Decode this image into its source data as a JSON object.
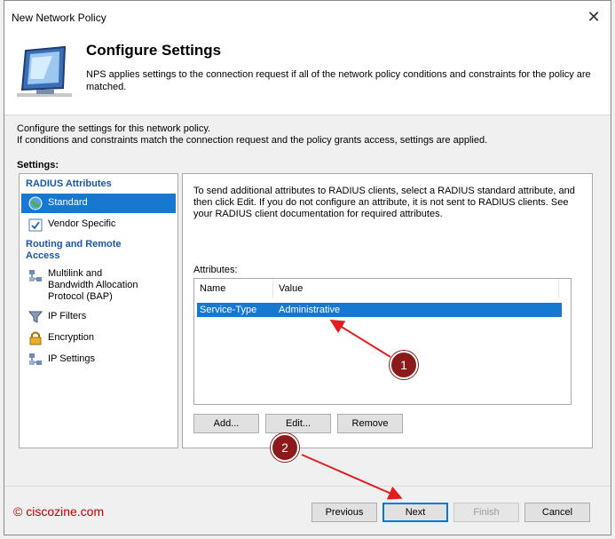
{
  "window": {
    "title": "New Network Policy"
  },
  "header": {
    "heading": "Configure Settings",
    "description": "NPS applies settings to the connection request if all of the network policy conditions and constraints for the policy are matched."
  },
  "intro": {
    "line1": "Configure the settings for this network policy.",
    "line2": "If conditions and constraints match the connection request and the policy grants access, settings are applied."
  },
  "settings_label": "Settings:",
  "nav": {
    "group1": "RADIUS Attributes",
    "standard": "Standard",
    "vendor": "Vendor Specific",
    "group2": "Routing and Remote Access",
    "multilink": "Multilink and Bandwidth Allocation Protocol (BAP)",
    "ipfilters": "IP Filters",
    "encryption": "Encryption",
    "ipsettings": "IP Settings"
  },
  "right": {
    "description": "To send additional attributes to RADIUS clients, select a RADIUS standard attribute, and then click Edit. If you do not configure an attribute, it is not sent to RADIUS clients. See your RADIUS client documentation for required attributes.",
    "attributes_label": "Attributes:",
    "columns": {
      "name": "Name",
      "value": "Value"
    },
    "rows": [
      {
        "name": "Service-Type",
        "value": "Administrative"
      }
    ],
    "buttons": {
      "add": "Add...",
      "edit": "Edit...",
      "remove": "Remove"
    }
  },
  "footer": {
    "previous": "Previous",
    "next": "Next",
    "finish": "Finish",
    "cancel": "Cancel",
    "watermark": "© ciscozine.com"
  },
  "annotations": {
    "one": "1",
    "two": "2"
  },
  "colors": {
    "selection": "#1678d0",
    "annotation": "#8b1a1a",
    "arrow": "#e02020"
  }
}
